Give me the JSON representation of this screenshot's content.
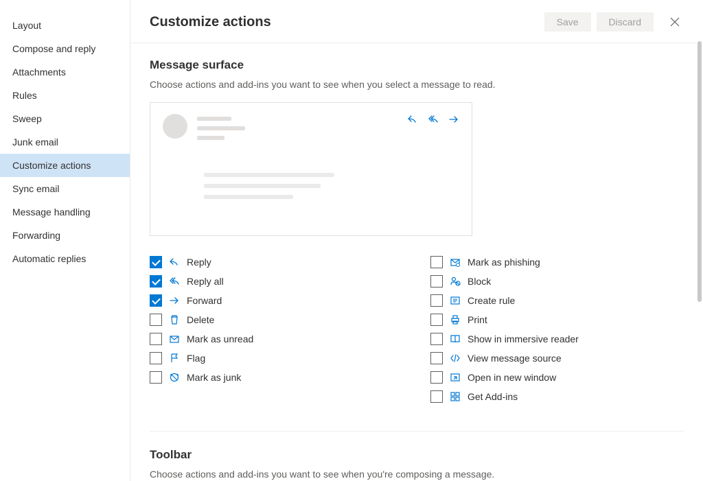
{
  "sidebar": {
    "items": [
      {
        "label": "Layout"
      },
      {
        "label": "Compose and reply"
      },
      {
        "label": "Attachments"
      },
      {
        "label": "Rules"
      },
      {
        "label": "Sweep"
      },
      {
        "label": "Junk email"
      },
      {
        "label": "Customize actions"
      },
      {
        "label": "Sync email"
      },
      {
        "label": "Message handling"
      },
      {
        "label": "Forwarding"
      },
      {
        "label": "Automatic replies"
      }
    ],
    "selected_index": 6
  },
  "header": {
    "title": "Customize actions",
    "save_label": "Save",
    "discard_label": "Discard"
  },
  "sections": {
    "surface": {
      "title": "Message surface",
      "desc": "Choose actions and add-ins you want to see when you select a message to read.",
      "left": [
        {
          "label": "Reply",
          "checked": true,
          "icon": "reply"
        },
        {
          "label": "Reply all",
          "checked": true,
          "icon": "reply-all"
        },
        {
          "label": "Forward",
          "checked": true,
          "icon": "forward"
        },
        {
          "label": "Delete",
          "checked": false,
          "icon": "delete"
        },
        {
          "label": "Mark as unread",
          "checked": false,
          "icon": "mail"
        },
        {
          "label": "Flag",
          "checked": false,
          "icon": "flag"
        },
        {
          "label": "Mark as junk",
          "checked": false,
          "icon": "junk"
        }
      ],
      "right": [
        {
          "label": "Mark as phishing",
          "checked": false,
          "icon": "phishing"
        },
        {
          "label": "Block",
          "checked": false,
          "icon": "block"
        },
        {
          "label": "Create rule",
          "checked": false,
          "icon": "rule"
        },
        {
          "label": "Print",
          "checked": false,
          "icon": "print"
        },
        {
          "label": "Show in immersive reader",
          "checked": false,
          "icon": "reader"
        },
        {
          "label": "View message source",
          "checked": false,
          "icon": "source"
        },
        {
          "label": "Open in new window",
          "checked": false,
          "icon": "window"
        },
        {
          "label": "Get Add-ins",
          "checked": false,
          "icon": "addins"
        }
      ]
    },
    "toolbar": {
      "title": "Toolbar",
      "desc": "Choose actions and add-ins you want to see when you're composing a message."
    }
  },
  "colors": {
    "accent": "#0078d4"
  }
}
